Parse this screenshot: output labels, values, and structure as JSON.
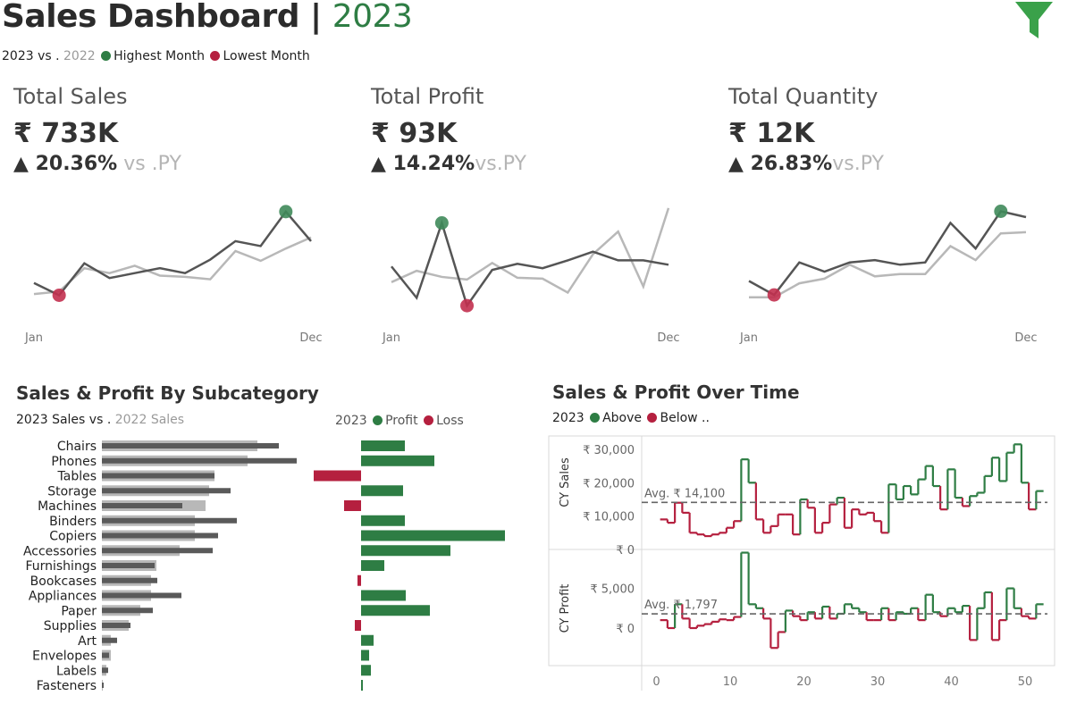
{
  "header": {
    "title": "Sales Dashboard | ",
    "year": "2023",
    "legend": {
      "cy": "2023 vs .",
      "py": "2022",
      "highest": "Highest  Month",
      "lowest": "Lowest Month"
    }
  },
  "colors": {
    "green": "#2e7d44",
    "red": "#b5203f",
    "dark": "#555555",
    "light": "#b8b8b8"
  },
  "kpis": [
    {
      "title": "Total Sales",
      "value": "₹ 733K",
      "delta": "▲ 20.36%",
      "vs": " vs .PY"
    },
    {
      "title": "Total Profit",
      "value": "₹ 93K",
      "delta": "▲ 14.24%",
      "vs": "vs.PY"
    },
    {
      "title": "Total Quantity",
      "value": "₹ 12K",
      "delta": "▲ 26.83%",
      "vs": "vs.PY"
    }
  ],
  "subcat": {
    "title": "Sales & Profit By Subcategory",
    "sales_legend_cy": "2023 Sales vs .",
    "sales_legend_py": "2022 Sales",
    "profit_legend_year": "2023",
    "profit_legend_profit": "Profit",
    "profit_legend_loss": "Loss"
  },
  "overtime": {
    "title": "Sales & Profit Over Time",
    "legend_year": "2023",
    "legend_above": "Above",
    "legend_below": "Below .."
  },
  "chart_data": [
    {
      "type": "line",
      "name": "sales-sparkline",
      "x_labels": [
        "Jan",
        "Dec"
      ],
      "x": [
        1,
        2,
        3,
        4,
        5,
        6,
        7,
        8,
        9,
        10,
        11,
        12
      ],
      "series": [
        {
          "name": "2023",
          "values": [
            42,
            32,
            58,
            46,
            50,
            54,
            50,
            61,
            76,
            72,
            100,
            76
          ]
        },
        {
          "name": "2022",
          "values": [
            33,
            35,
            54,
            50,
            56,
            48,
            47,
            45,
            68,
            60,
            70,
            79
          ]
        }
      ],
      "highest_index": 10,
      "lowest_index": 1,
      "ylim": [
        20,
        105
      ]
    },
    {
      "type": "line",
      "name": "profit-sparkline",
      "x_labels": [
        "Jan",
        "Dec"
      ],
      "x": [
        1,
        2,
        3,
        4,
        5,
        6,
        7,
        8,
        9,
        10,
        11,
        12
      ],
      "series": [
        {
          "name": "2023",
          "values": [
            50,
            14,
            100,
            5,
            46,
            53,
            48,
            57,
            67,
            57,
            57,
            52
          ]
        },
        {
          "name": "2022",
          "values": [
            32,
            45,
            38,
            35,
            54,
            37,
            36,
            20,
            64,
            90,
            27,
            117
          ]
        }
      ],
      "highest_index": 2,
      "lowest_index": 3,
      "ylim": [
        0,
        120
      ]
    },
    {
      "type": "line",
      "name": "quantity-sparkline",
      "x_labels": [
        "Jan",
        "Dec"
      ],
      "x": [
        1,
        2,
        3,
        4,
        5,
        6,
        7,
        8,
        9,
        10,
        11,
        12
      ],
      "series": [
        {
          "name": "2023",
          "values": [
            40,
            28,
            56,
            48,
            56,
            58,
            54,
            56,
            90,
            68,
            100,
            95
          ]
        },
        {
          "name": "2022",
          "values": [
            26,
            26,
            38,
            42,
            54,
            44,
            46,
            46,
            70,
            58,
            81,
            82
          ]
        }
      ],
      "highest_index": 10,
      "lowest_index": 1,
      "ylim": [
        15,
        105
      ]
    },
    {
      "type": "bar",
      "name": "subcategory-sales",
      "categories": [
        "Chairs",
        "Phones",
        "Tables",
        "Storage",
        "Machines",
        "Binders",
        "Copiers",
        "Accessories",
        "Furnishings",
        "Bookcases",
        "Appliances",
        "Paper",
        "Supplies",
        "Art",
        "Envelopes",
        "Labels",
        "Fasteners"
      ],
      "series": [
        {
          "name": "2023",
          "values": [
            198,
            218,
            126,
            144,
            90,
            151,
            130,
            124,
            59,
            62,
            89,
            57,
            32,
            17,
            8,
            7,
            2
          ]
        },
        {
          "name": "2022",
          "values": [
            174,
            163,
            126,
            120,
            116,
            104,
            104,
            87,
            61,
            55,
            55,
            43,
            30,
            10,
            10,
            5,
            1
          ]
        }
      ]
    },
    {
      "type": "bar",
      "name": "subcategory-profit",
      "categories": [
        "Chairs",
        "Phones",
        "Tables",
        "Storage",
        "Machines",
        "Binders",
        "Copiers",
        "Accessories",
        "Furnishings",
        "Bookcases",
        "Appliances",
        "Paper",
        "Supplies",
        "Art",
        "Envelopes",
        "Labels",
        "Fasteners"
      ],
      "values": [
        4.9,
        8.2,
        -5.3,
        4.7,
        -1.9,
        4.9,
        16.1,
        10.0,
        2.6,
        -0.4,
        5.0,
        7.7,
        -0.7,
        1.4,
        0.9,
        1.1,
        0.2
      ]
    },
    {
      "type": "line",
      "name": "cy-sales-weekly",
      "xlabel": "",
      "ylabel": "CY Sales",
      "x_ticks": [
        0,
        10,
        20,
        30,
        40,
        50
      ],
      "y_ticks": [
        "₹ 0",
        "₹ 10,000",
        "₹ 20,000",
        "₹ 30,000"
      ],
      "average_label": "Avg. ₹ 14,100",
      "average": 14100,
      "x": [
        1,
        2,
        3,
        4,
        5,
        6,
        7,
        8,
        9,
        10,
        11,
        12,
        13,
        14,
        15,
        16,
        17,
        18,
        19,
        20,
        21,
        22,
        23,
        24,
        25,
        26,
        27,
        28,
        29,
        30,
        31,
        32,
        33,
        34,
        35,
        36,
        37,
        38,
        39,
        40,
        41,
        42,
        43,
        44,
        45,
        46,
        47,
        48,
        49,
        50,
        51,
        52
      ],
      "values": [
        9000,
        8000,
        14000,
        11000,
        5000,
        4500,
        4000,
        4500,
        5000,
        6500,
        8500,
        27000,
        20000,
        9000,
        5000,
        7000,
        10500,
        10500,
        4500,
        15000,
        12500,
        5000,
        8000,
        13500,
        15500,
        6500,
        12000,
        10500,
        11000,
        8500,
        5000,
        19500,
        15000,
        19000,
        16500,
        21000,
        25000,
        19000,
        12000,
        24000,
        15500,
        13000,
        16000,
        17000,
        22000,
        27500,
        20500,
        29000,
        31500,
        20000,
        12000,
        17500
      ],
      "ylim": [
        0,
        34000
      ],
      "xlim": [
        -2,
        54
      ]
    },
    {
      "type": "line",
      "name": "cy-profit-weekly",
      "xlabel": "",
      "ylabel": "CY Profit",
      "x_ticks": [
        0,
        10,
        20,
        30,
        40,
        50
      ],
      "y_ticks": [
        "₹ 0",
        "₹ 5,000"
      ],
      "average_label": "Avg. ₹ 1,797",
      "average": 1797,
      "x": [
        1,
        2,
        3,
        4,
        5,
        6,
        7,
        8,
        9,
        10,
        11,
        12,
        13,
        14,
        15,
        16,
        17,
        18,
        19,
        20,
        21,
        22,
        23,
        24,
        25,
        26,
        27,
        28,
        29,
        30,
        31,
        32,
        33,
        34,
        35,
        36,
        37,
        38,
        39,
        40,
        41,
        42,
        43,
        44,
        45,
        46,
        47,
        48,
        49,
        50,
        51,
        52
      ],
      "values": [
        1000,
        0,
        3000,
        1200,
        0,
        300,
        500,
        800,
        1100,
        1000,
        1400,
        9500,
        3000,
        2500,
        1200,
        -2500,
        -500,
        2200,
        1500,
        1000,
        2000,
        1200,
        2700,
        1200,
        1800,
        3000,
        2500,
        2000,
        1000,
        1000,
        2500,
        1000,
        2000,
        1800,
        2500,
        1000,
        4200,
        2000,
        1500,
        2500,
        2000,
        2800,
        -1500,
        2500,
        4500,
        -1500,
        1000,
        5000,
        2500,
        1500,
        1200,
        3000
      ],
      "ylim": [
        -4500,
        9900
      ],
      "xlim": [
        -2,
        54
      ]
    }
  ]
}
